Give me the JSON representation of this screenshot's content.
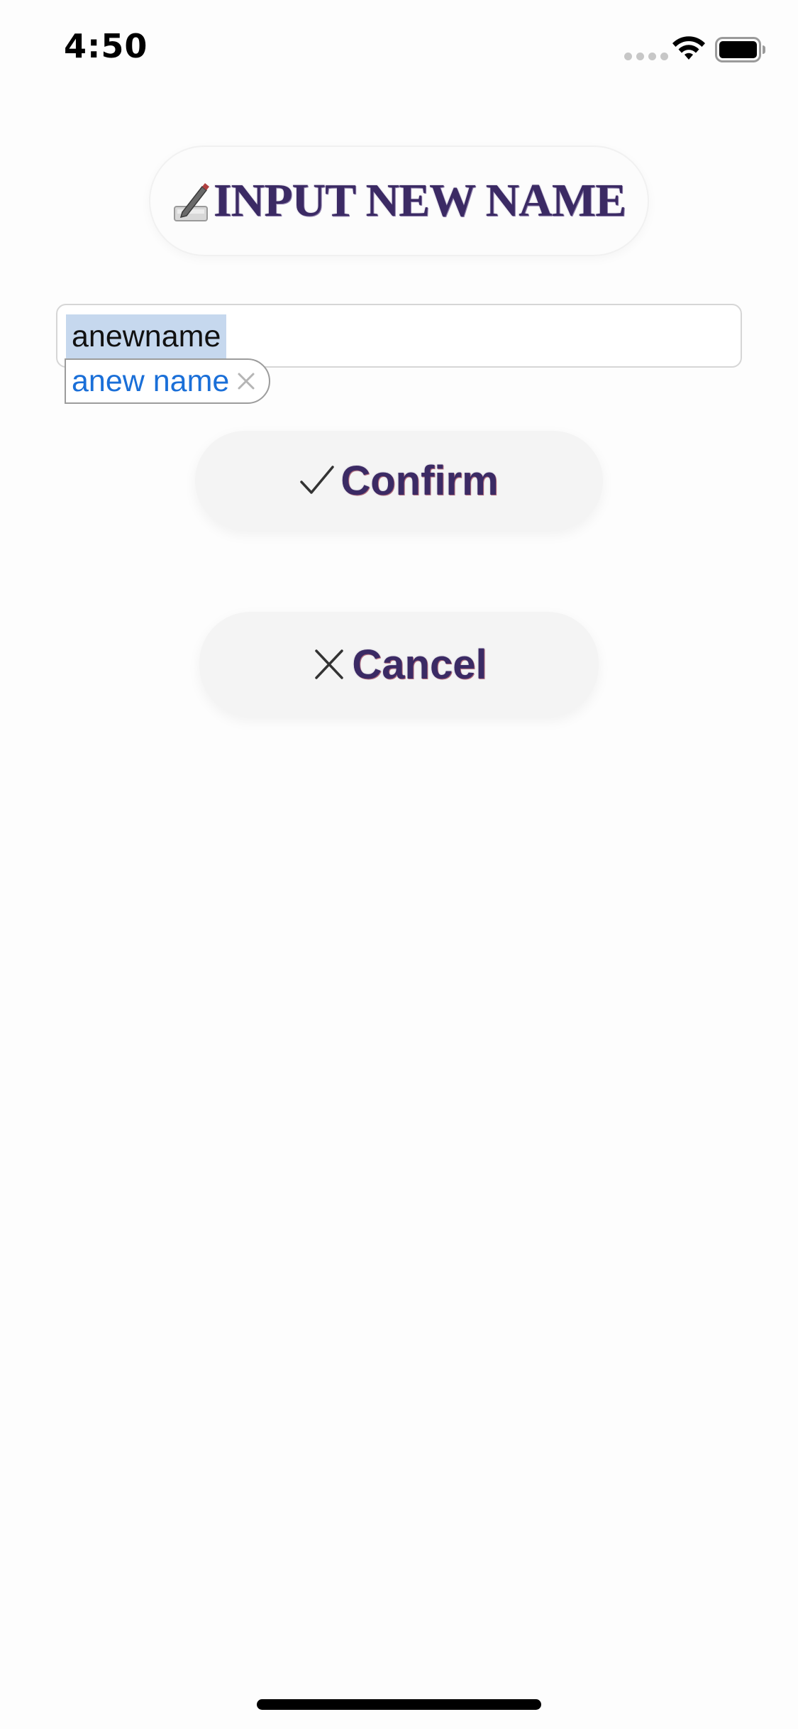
{
  "status_bar": {
    "time": "4:50",
    "wifi_icon": "wifi-icon",
    "battery_icon": "battery-icon",
    "signal_icon": "cellular-signal-icon"
  },
  "title": {
    "icon": "pencil-writing-icon",
    "text": "INPUT NEW NAME"
  },
  "name_input": {
    "value": "anewname",
    "selected": true
  },
  "autocorrect": {
    "suggestion": "anew name",
    "dismiss_icon": "close-icon"
  },
  "buttons": {
    "confirm": {
      "icon": "checkmark-icon",
      "label": "Confirm"
    },
    "cancel": {
      "icon": "close-icon",
      "label": "Cancel"
    }
  },
  "colors": {
    "title_text": "#3b2a64",
    "selection_highlight": "#c6d8ee",
    "suggestion_text": "#1a6fd8",
    "button_background": "#f4f4f4",
    "page_background": "#fdfdfd"
  }
}
